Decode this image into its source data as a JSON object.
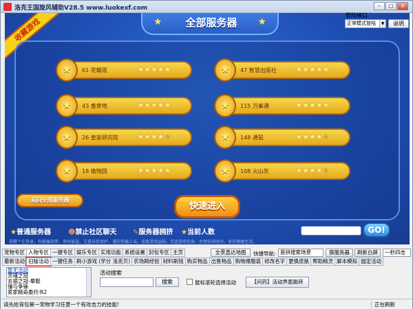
{
  "window": {
    "title": "洛克王国旋风辅助V28.5 www.luokexf.com",
    "minimize": "–",
    "maximize": "□",
    "close": "×"
  },
  "login": {
    "label": "登陆接口",
    "selected": "正常模式登陆",
    "help_button": "说明"
  },
  "game": {
    "ribbon": "收藏游戏",
    "banner_title": "全部服务器",
    "servers": [
      {
        "id": "61",
        "name": "花瓣雨",
        "stars": 5,
        "lit": 5
      },
      {
        "id": "47",
        "name": "智慧出版社",
        "stars": 5,
        "lit": 5
      },
      {
        "id": "43",
        "name": "香草地",
        "stars": 5,
        "lit": 5
      },
      {
        "id": "115",
        "name": "万事通",
        "stars": 5,
        "lit": 5
      },
      {
        "id": "26",
        "name": "皇家研究院",
        "stars": 5,
        "lit": 4
      },
      {
        "id": "148",
        "name": "通鼠",
        "stars": 5,
        "lit": 4
      },
      {
        "id": "18",
        "name": "植物园",
        "stars": 5,
        "lit": 5
      },
      {
        "id": "108",
        "name": "火山灰",
        "stars": 5,
        "lit": 4
      }
    ],
    "back_button": "返回全部服务器",
    "quick_button": "快速进入",
    "legend": {
      "normal": "普通服务器",
      "no_chat": "禁止社区聊天",
      "busy": "服务器拥挤",
      "current": "当前人数"
    },
    "go_button": "GO!",
    "notice": "提醒个在登录，和被骗指责、密码被盗。注重自我保护，谨防受骗上当。适度游戏益脑，沉迷游戏伤身。合理安排时间，享受健康生活。"
  },
  "tabs_row1": [
    "宠物专区",
    "人物专区",
    "一键专区",
    "娱乐专区",
    "实用功能",
    "系统设置",
    "封包专区",
    "主页"
  ],
  "tabs_row1_right": {
    "map_button": "全景直达地图",
    "quick_nav_label": "快捷导航:",
    "quick_nav_value": "首拼搜索场景",
    "swap_button": "换服务器",
    "refresh_button": "刷新白屏",
    "combo_value": "一秒四击"
  },
  "tabs_row2": [
    "最新活动",
    "旧版活动",
    "一键任务",
    "刷小游戏 (学分 洛克贝)",
    "农场刷经验",
    "材料刷钱",
    "购买物品",
    "出售物品",
    "购物爆服装",
    "修改名字",
    "更换皮肤",
    "帮助精灵",
    "脚本模拟",
    "固定活动"
  ],
  "activity_list": [
    "暂无活动",
    "灵魂之冠",
    "玄德之冠-晕鞋",
    "懂与争锋",
    "家家精奇委托书2"
  ],
  "search": {
    "label": "活动搜索",
    "button": "搜索",
    "checkbox_label": "鼠标滚轮选择活动",
    "jump_button": "【问药】活动界面跳转"
  },
  "status": {
    "message": "请先给背包第一宠物学习任意一个有攻击力的技能!",
    "right": "正在刷新"
  }
}
